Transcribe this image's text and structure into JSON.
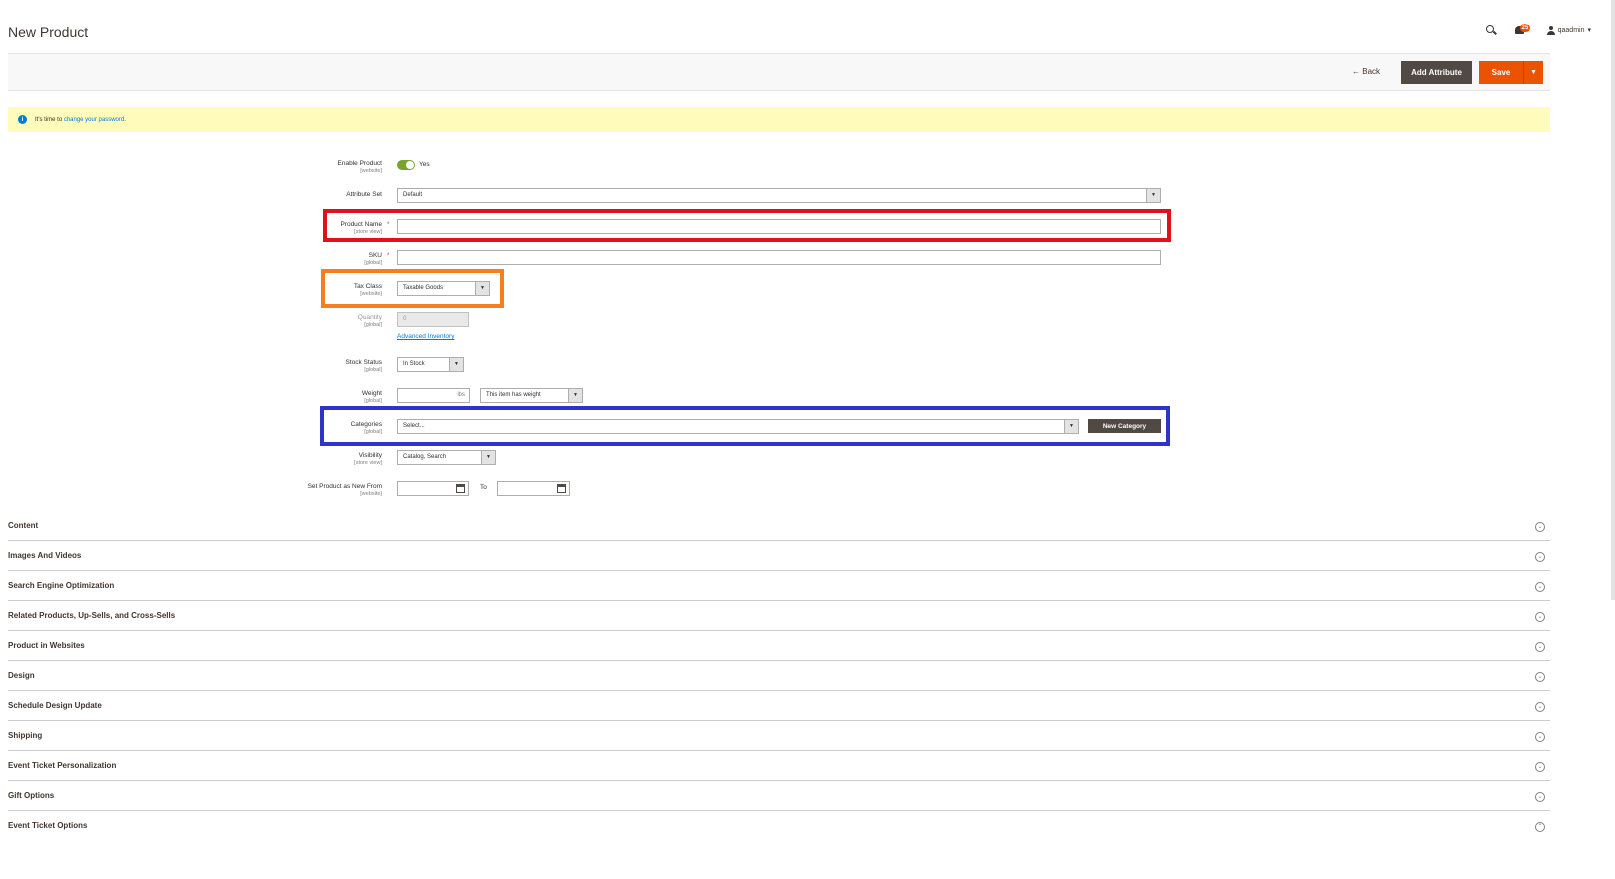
{
  "header": {
    "page_title": "New Product",
    "notification_count": "25",
    "username": "qaadmin",
    "user_caret": "▾"
  },
  "actions": {
    "back_label": "Back",
    "back_icon": "←",
    "add_attribute_label": "Add Attribute",
    "save_label": "Save",
    "save_menu_icon": "▼"
  },
  "notice": {
    "icon": "i",
    "prefix": "It's time to ",
    "link_text": "change your password",
    "suffix": "."
  },
  "form": {
    "enable_product": {
      "label": "Enable Product",
      "scope": "[website]",
      "value": "Yes"
    },
    "attribute_set": {
      "label": "Attribute Set",
      "value": "Default"
    },
    "product_name": {
      "label": "Product Name",
      "scope": "[store view]",
      "value": "",
      "required_mark": "*"
    },
    "sku": {
      "label": "SKU",
      "scope": "[global]",
      "value": "",
      "required_mark": "*"
    },
    "tax_class": {
      "label": "Tax Class",
      "scope": "[website]",
      "value": "Taxable Goods"
    },
    "quantity": {
      "label": "Quantity",
      "scope": "[global]",
      "value": "0",
      "link": "Advanced Inventory"
    },
    "stock_status": {
      "label": "Stock Status",
      "scope": "[global]",
      "value": "In Stock"
    },
    "weight": {
      "label": "Weight",
      "scope": "[global]",
      "value": "",
      "unit": "lbs",
      "type_value": "This item has weight"
    },
    "categories": {
      "label": "Categories",
      "scope": "[global]",
      "placeholder": "Select...",
      "button": "New Category"
    },
    "visibility": {
      "label": "Visibility",
      "scope": "[store view]",
      "value": "Catalog, Search"
    },
    "new_from": {
      "label": "Set Product as New From",
      "scope": "[website]",
      "from": "",
      "to_label": "To",
      "to": ""
    },
    "select_arrow": "▼"
  },
  "sections": [
    "Content",
    "Images And Videos",
    "Search Engine Optimization",
    "Related Products, Up-Sells, and Cross-Sells",
    "Product in Websites",
    "Design",
    "Schedule Design Update",
    "Shipping",
    "Event Ticket Personalization",
    "Gift Options",
    "Event Ticket Options"
  ],
  "section_chevron_icons": [
    "⌄",
    "⌄",
    "⌄",
    "⌄",
    "⌄",
    "⌄",
    "⌄",
    "⌄",
    "⌄",
    "⌄",
    "⌃"
  ],
  "colors": {
    "accent": "#eb5202",
    "dark_button": "#514943",
    "link": "#007bdb",
    "toggle_on": "#79a22e",
    "highlight_red": "#e0111c",
    "highlight_orange": "#f57f20",
    "highlight_blue": "#2e33c9"
  }
}
